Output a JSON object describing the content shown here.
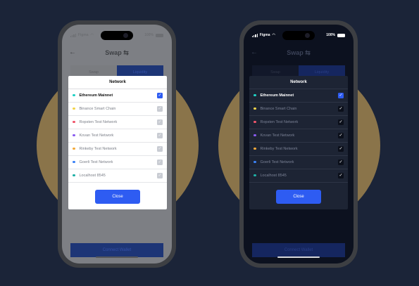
{
  "light": {
    "status": {
      "carrier": "Figma",
      "battery": "100%"
    },
    "header": {
      "back_icon": "←",
      "title": "Swap ⇆"
    },
    "tabs": [
      {
        "label": "Swap"
      },
      {
        "label": "Liquidity"
      }
    ],
    "connect_label": "Connect Wallet",
    "modal": {
      "title": "Network",
      "close_label": "Close",
      "networks": [
        {
          "label": "Ethereum Mainnet",
          "check": "✓"
        },
        {
          "label": "Binance Smart Chain",
          "check": "✓"
        },
        {
          "label": "Ropsten Test Network",
          "check": "✓"
        },
        {
          "label": "Kovan Test Network",
          "check": "✓"
        },
        {
          "label": "Rinkeby Test Network",
          "check": "✓"
        },
        {
          "label": "Goerli Test Network",
          "check": "✓"
        },
        {
          "label": "Localhost 8545",
          "check": "✓"
        }
      ]
    }
  },
  "dark": {
    "status": {
      "carrier": "Figma",
      "battery": "100%"
    },
    "header": {
      "back_icon": "←",
      "title": "Swap ⇆"
    },
    "tabs": [
      {
        "label": "Swap"
      },
      {
        "label": "Liquidity"
      }
    ],
    "connect_label": "Connect Wallet",
    "modal": {
      "title": "Network",
      "close_label": "Close",
      "networks": [
        {
          "label": "Ethereum Mainnet",
          "check": "✓"
        },
        {
          "label": "Binance Smart Chain",
          "check": "✓"
        },
        {
          "label": "Ropsten Test Network",
          "check": "✓"
        },
        {
          "label": "Kovan Test Network",
          "check": "✓"
        },
        {
          "label": "Rinkeby Test Network",
          "check": "✓"
        },
        {
          "label": "Goerli Test Network",
          "check": "✓"
        },
        {
          "label": "Localhost 8545",
          "check": "✓"
        }
      ]
    }
  },
  "colors": {
    "background": "#1b2438",
    "circle": "#8a744a",
    "accent": "#2e5cf2",
    "network_dots": [
      "#1fd1c4",
      "#f2d34a",
      "#f0556b",
      "#8a5cf0",
      "#f2a93b",
      "#3b82f6",
      "#1fb0a6"
    ]
  }
}
